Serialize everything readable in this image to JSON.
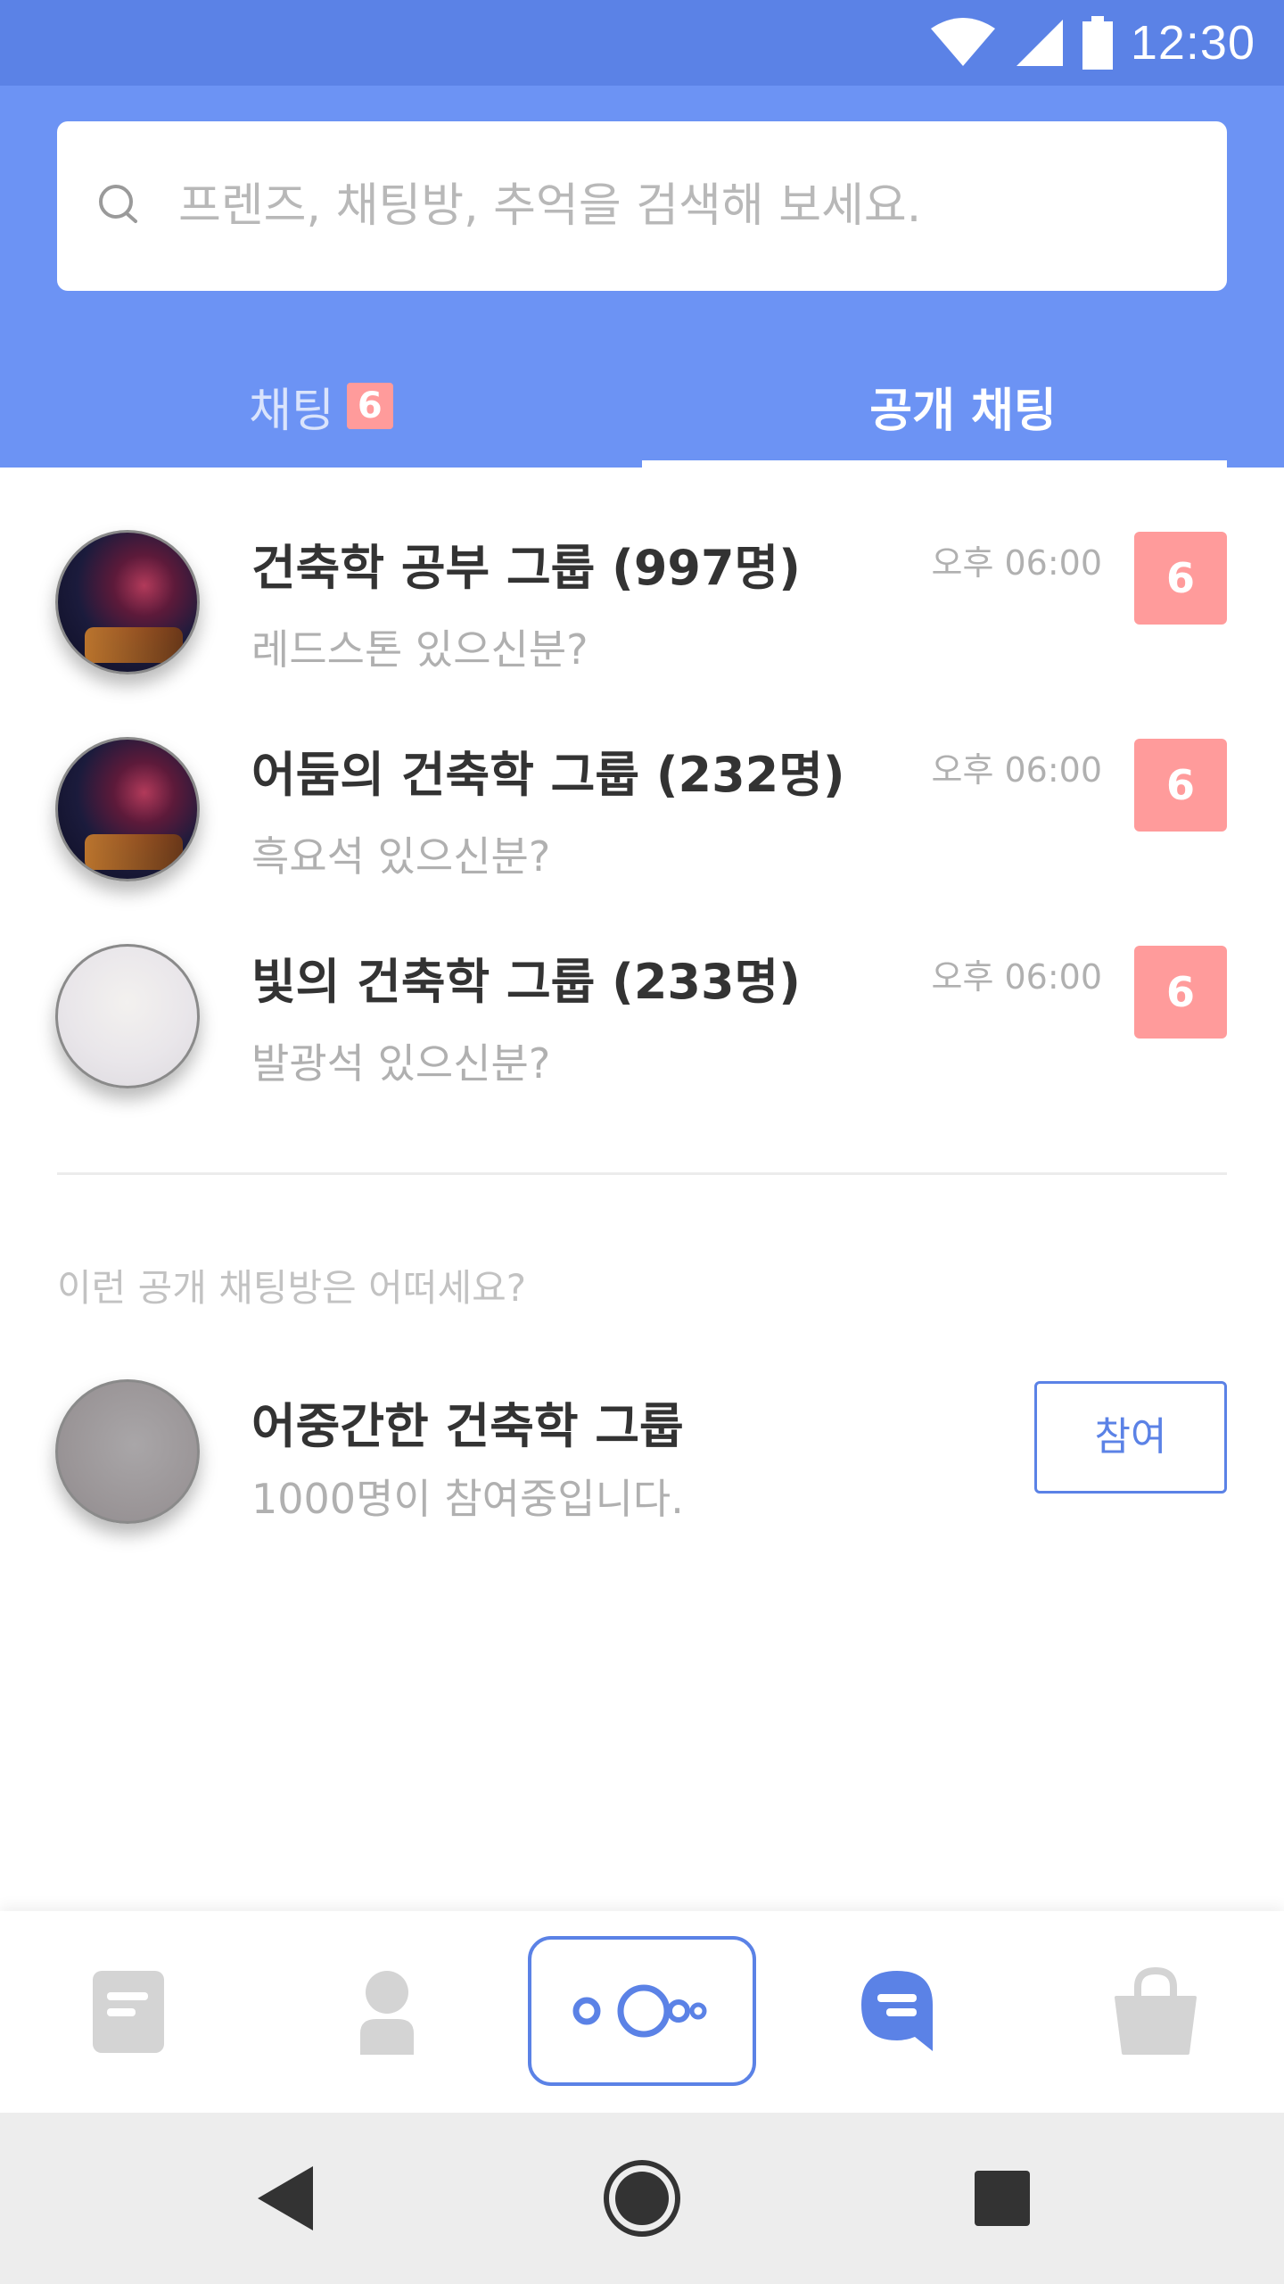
{
  "status_bar": {
    "time": "12:30",
    "icons": [
      "wifi-icon",
      "cellular-signal-icon",
      "battery-icon"
    ],
    "background": "#5b82e6"
  },
  "header": {
    "background": "#6c93f4",
    "search": {
      "placeholder": "프렌즈, 채팅방, 추억을 검색해 보세요."
    },
    "tabs": [
      {
        "label": "채팅",
        "badge": "6",
        "active": false
      },
      {
        "label": "공개 채팅",
        "active": true
      }
    ]
  },
  "chats": [
    {
      "title": "건축학 공부 그룹 (997명)",
      "preview": "레드스톤 있으신분?",
      "time": "오후 06:00",
      "unread": "6",
      "avatar": "dark"
    },
    {
      "title": "어둠의 건축학 그룹 (232명)",
      "preview": "흑요석 있으신분?",
      "time": "오후 06:00",
      "unread": "6",
      "avatar": "dark"
    },
    {
      "title": "빛의 건축학 그룹 (233명)",
      "preview": "발광석 있으신분?",
      "time": "오후 06:00",
      "unread": "6",
      "avatar": "light"
    }
  ],
  "recommend": {
    "section_label": "이런 공개 채팅방은 어떠세요?",
    "title": "어중간한 건축학 그룹",
    "subtitle": "1000명이 참여중입니다.",
    "join_label": "참여"
  },
  "bottom_nav": {
    "items": [
      "document-icon",
      "person-icon",
      "open-chat-bubbles-icon",
      "chat-bubble-icon",
      "shopping-bag-icon"
    ],
    "accent": "#5b82e6",
    "inactive": "#d4d4d4"
  },
  "system_nav": {
    "items": [
      "back-icon",
      "home-icon",
      "recents-icon"
    ]
  },
  "colors": {
    "badge": "#ff9b9b",
    "title_text": "#333333",
    "muted_text": "#b0b0b0"
  }
}
